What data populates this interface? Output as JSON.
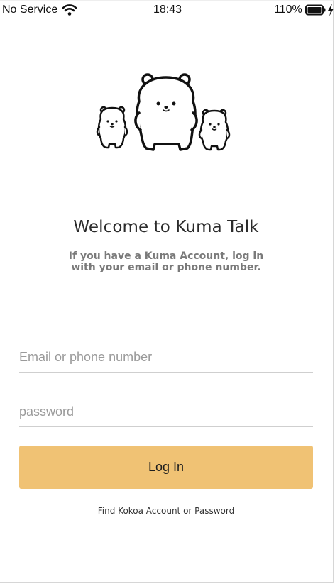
{
  "status_bar": {
    "carrier": "No Service",
    "time": "18:43",
    "battery": "110%",
    "icons": [
      "wifi-icon",
      "battery-icon",
      "charging-icon"
    ]
  },
  "hero": {
    "illustration": "bear-family-icon"
  },
  "welcome": {
    "title": "Welcome to Kuma Talk",
    "subtitle": "If you have a Kuma Account, log in with your email or phone number."
  },
  "form": {
    "email": {
      "value": "",
      "placeholder": "Email or phone number"
    },
    "password": {
      "value": "",
      "placeholder": "password"
    },
    "login_label": "Log In",
    "find_account_label": "Find Kokoa Account or Password"
  },
  "colors": {
    "accent": "#f0c274",
    "divider": "#cfcfcf",
    "subtitle": "#7a7a7a"
  }
}
